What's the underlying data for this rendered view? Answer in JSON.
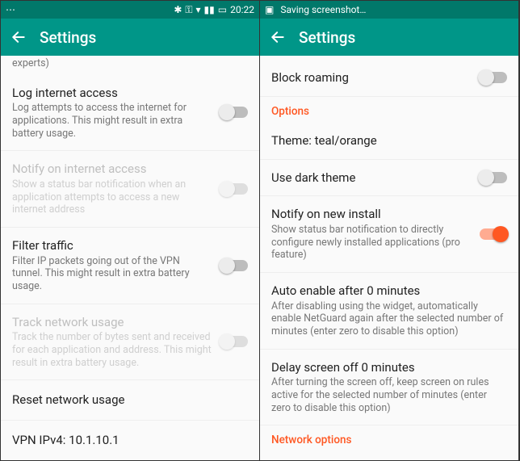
{
  "left": {
    "status": {
      "overflow": "⋯",
      "bluetooth": "✱",
      "key": "⚿",
      "wifi": "▾",
      "signal": "▮▮",
      "battery": "▭",
      "time": "20:22"
    },
    "appbar": {
      "title": "Settings"
    },
    "items": {
      "experts_fragment": "experts)",
      "log_access": {
        "title": "Log internet access",
        "subtitle": "Log attempts to access the internet for applications. This might result in extra battery usage."
      },
      "notify_access": {
        "title": "Notify on internet access",
        "subtitle": "Show a status bar notification when an application attempts to access a new internet address"
      },
      "filter_traffic": {
        "title": "Filter traffic",
        "subtitle": "Filter IP packets going out of the VPN tunnel. This might result in extra battery usage."
      },
      "track_usage": {
        "title": "Track network usage",
        "subtitle": "Track the number of bytes sent and received for each application and address. This might result in extra battery usage."
      },
      "reset_usage": {
        "title": "Reset network usage"
      },
      "vpn_ipv4": {
        "title": "VPN IPv4: 10.1.10.1"
      }
    }
  },
  "right": {
    "status": {
      "icon": "▣",
      "text": "Saving screenshot…"
    },
    "appbar": {
      "title": "Settings"
    },
    "section_options": "Options",
    "section_network": "Network options",
    "items": {
      "block_roaming": {
        "title": "Block roaming"
      },
      "theme": {
        "title": "Theme: teal/orange"
      },
      "dark_theme": {
        "title": "Use dark theme"
      },
      "notify_install": {
        "title": "Notify on new install",
        "subtitle": "Show status bar notification to directly configure newly installed applications (pro feature)"
      },
      "auto_enable": {
        "title": "Auto enable after 0 minutes",
        "subtitle": "After disabling using the widget, automatically enable NetGuard again after the selected number of minutes (enter zero to disable this option)"
      },
      "delay_screen": {
        "title": "Delay screen off 0 minutes",
        "subtitle": "After turning the screen off, keep screen on rules active for the selected number of minutes (enter zero to disable this option)"
      }
    }
  }
}
